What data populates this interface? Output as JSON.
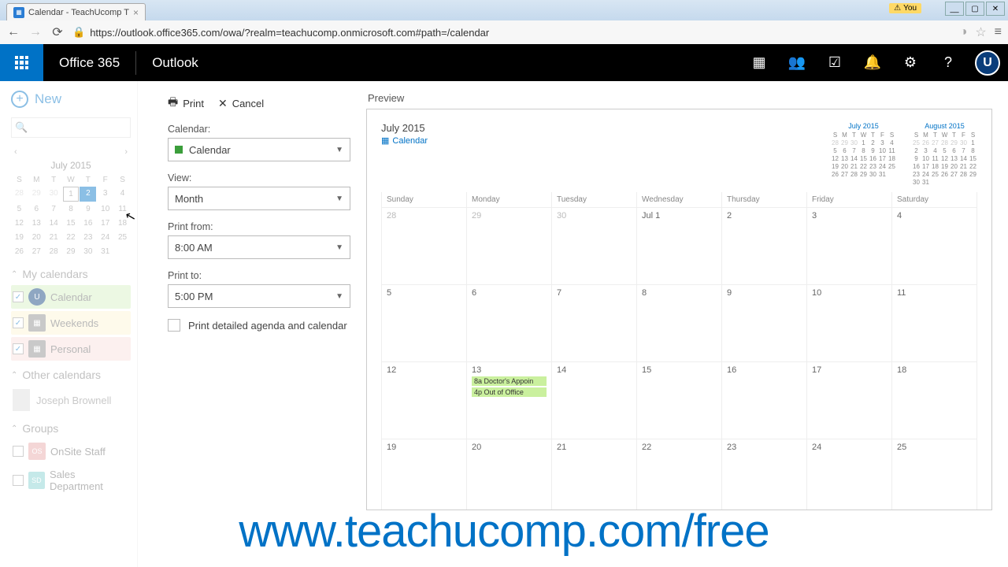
{
  "browser": {
    "tab_title": "Calendar - TeachUcomp T",
    "you_badge": "You",
    "url_display": "https://outlook.office365.com/owa/?realm=teachucomp.onmicrosoft.com#path=/calendar"
  },
  "header": {
    "suite": "Office 365",
    "app": "Outlook",
    "avatar_letter": "U"
  },
  "sidebar": {
    "new_label": "New",
    "mini_title": "July 2015",
    "dow": [
      "S",
      "M",
      "T",
      "W",
      "T",
      "F",
      "S"
    ],
    "sections": {
      "my": "My calendars",
      "other": "Other calendars",
      "groups": "Groups"
    },
    "cals": {
      "calendar": "Calendar",
      "weekends": "Weekends",
      "personal": "Personal",
      "person": "Joseph Brownell",
      "onsite": "OnSite Staff",
      "sales": "Sales Department"
    }
  },
  "print": {
    "print_btn": "Print",
    "cancel_btn": "Cancel",
    "calendar_label": "Calendar:",
    "calendar_value": "Calendar",
    "view_label": "View:",
    "view_value": "Month",
    "from_label": "Print from:",
    "from_value": "8:00 AM",
    "to_label": "Print to:",
    "to_value": "5:00 PM",
    "detailed_label": "Print detailed agenda and calendar"
  },
  "preview": {
    "label": "Preview",
    "month_title": "July 2015",
    "calendar_name": "Calendar",
    "mini1_title": "July 2015",
    "mini2_title": "August 2015",
    "dow": [
      "Sunday",
      "Monday",
      "Tuesday",
      "Wednesday",
      "Thursday",
      "Friday",
      "Saturday"
    ],
    "weeks": [
      [
        "28",
        "29",
        "30",
        "Jul 1",
        "2",
        "3",
        "4"
      ],
      [
        "5",
        "6",
        "7",
        "8",
        "9",
        "10",
        "11"
      ],
      [
        "12",
        "13",
        "14",
        "15",
        "16",
        "17",
        "18"
      ],
      [
        "19",
        "20",
        "21",
        "22",
        "23",
        "24",
        "25"
      ]
    ],
    "events_13": [
      "8a Doctor's Appoin",
      "4p Out of Office"
    ]
  },
  "watermark": "www.teachucomp.com/free"
}
